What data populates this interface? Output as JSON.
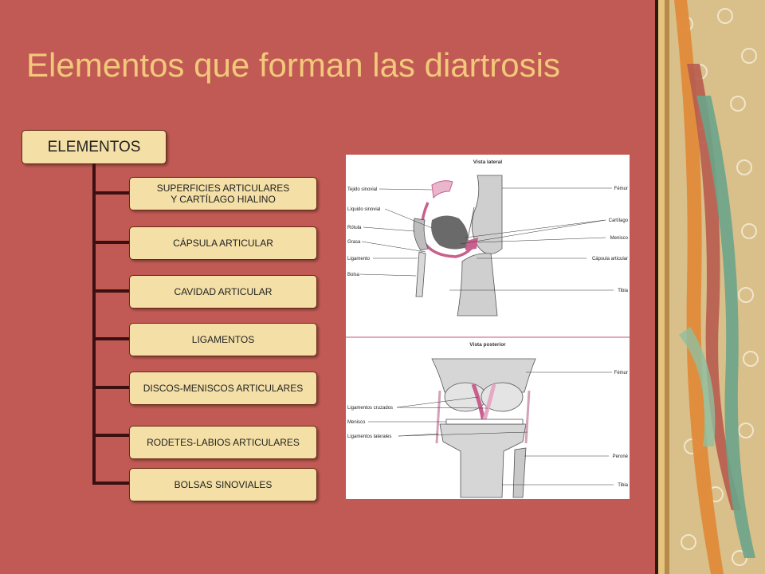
{
  "slide": {
    "title": "Elementos que forman las diartrosis"
  },
  "diagram": {
    "root_label": "ELEMENTOS",
    "items": [
      "SUPERFICIES ARTICULARES\n Y CARTÍLAGO  HIALINO",
      "CÁPSULA ARTICULAR",
      "CAVIDAD ARTICULAR",
      "LIGAMENTOS",
      "DISCOS-MENISCOS  ARTICULARES",
      "RODETES-LABIOS  ARTICULARES",
      "BOLSAS SINOVIALES"
    ]
  },
  "illustration": {
    "lateral_title": "Vista lateral",
    "posterior_title": "Vista posterior",
    "lateral_left_labels": [
      "Tejido sinovial",
      "Líquido sinovial",
      "Rótula",
      "Grasa",
      "Ligamento",
      "Bolsa"
    ],
    "lateral_right_labels": [
      "Fémur",
      "Cartílago",
      "Menisco",
      "Cápsula articular",
      "Tibia"
    ],
    "posterior_left_labels": [
      "Ligamentos cruzados",
      "Menisco",
      "Ligamentos laterales"
    ],
    "posterior_right_labels": [
      "Fémur",
      "Peroné",
      "Tibia"
    ]
  },
  "colors": {
    "background": "#c15a54",
    "title": "#f2c97a",
    "box_fill": "#f4dfa6",
    "box_border": "#6b2a15",
    "connector": "#3a1010"
  }
}
